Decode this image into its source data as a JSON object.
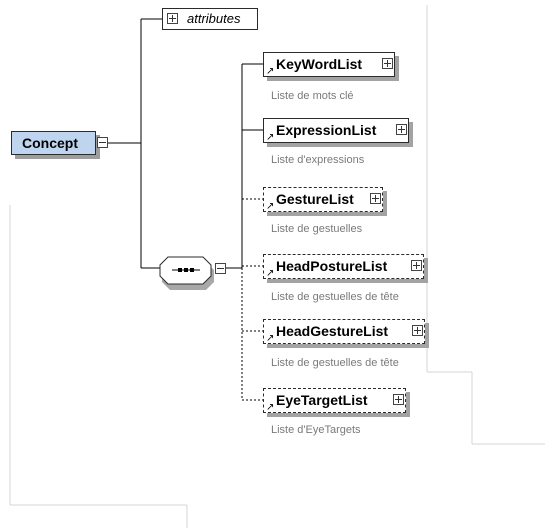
{
  "concept": {
    "name": "Concept",
    "color": "#bfd5ef"
  },
  "attributes": {
    "label": "attributes"
  },
  "sequence": {
    "icon": "sequence-compositor-icon"
  },
  "elements": [
    {
      "name": "KeyWordList",
      "description": "Liste de mots clé",
      "optional": false
    },
    {
      "name": "ExpressionList",
      "description": "Liste d'expressions",
      "optional": false
    },
    {
      "name": "GestureList",
      "description": "Liste de gestuelles",
      "optional": true
    },
    {
      "name": "HeadPostureList",
      "description": "Liste de gestuelles de tête",
      "optional": true
    },
    {
      "name": "HeadGestureList",
      "description": "Liste de gestuelles de tête",
      "optional": true
    },
    {
      "name": "EyeTargetList",
      "description": "Liste d'EyeTargets",
      "optional": true
    }
  ]
}
